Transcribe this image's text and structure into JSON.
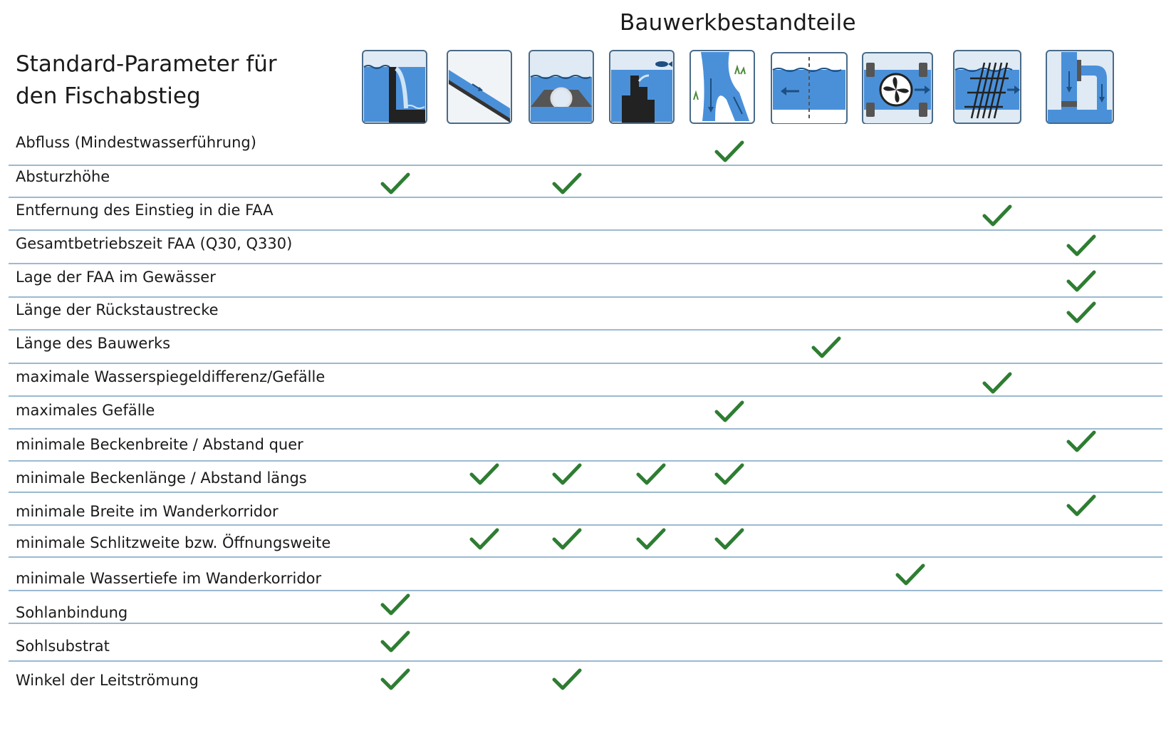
{
  "header": {
    "title": "Bauwerkbestandteile"
  },
  "table": {
    "title_lines": [
      "Standard-Parameter für",
      "den Fischabstieg"
    ],
    "columns": [
      {
        "icon": "waterfall-weir-icon"
      },
      {
        "icon": "ramp-slope-icon"
      },
      {
        "icon": "culvert-pipe-icon"
      },
      {
        "icon": "fish-pass-steps-icon"
      },
      {
        "icon": "river-bypass-icon"
      },
      {
        "icon": "channel-flow-icon"
      },
      {
        "icon": "turbine-icon"
      },
      {
        "icon": "screen-rake-icon"
      },
      {
        "icon": "bypass-pipe-icon"
      }
    ],
    "rows": [
      {
        "label": "Abfluss (Mindestwasserführung)",
        "checks": [
          5
        ]
      },
      {
        "label": "Absturzhöhe",
        "checks": [
          1,
          3
        ]
      },
      {
        "label": "Entfernung des Einstieg in die FAA",
        "checks": [
          8
        ]
      },
      {
        "label": "Gesamtbetriebszeit  FAA (Q30, Q330)",
        "checks": [
          9
        ]
      },
      {
        "label": "Lage der FAA im Gewässer",
        "checks": [
          9
        ]
      },
      {
        "label": "Länge der Rückstaustrecke",
        "checks": [
          9
        ]
      },
      {
        "label": "Länge des Bauwerks",
        "checks": [
          6
        ]
      },
      {
        "label": "maximale Wasserspiegeldifferenz/Gefälle",
        "checks": [
          8
        ]
      },
      {
        "label": "maximales Gefälle",
        "checks": [
          5
        ]
      },
      {
        "label": "minimale Beckenbreite / Abstand quer",
        "checks": [
          9
        ]
      },
      {
        "label": "minimale Beckenlänge / Abstand längs",
        "checks": [
          2,
          3,
          4,
          5
        ]
      },
      {
        "label": "minimale Breite im Wanderkorridor",
        "checks": [
          9
        ]
      },
      {
        "label": "minimale Schlitzweite bzw. Öffnungsweite",
        "checks": [
          2,
          3,
          4,
          5
        ]
      },
      {
        "label": "minimale Wassertiefe im Wanderkorridor",
        "checks": [
          7
        ]
      },
      {
        "label": "Sohlanbindung",
        "checks": [
          1
        ]
      },
      {
        "label": "Sohlsubstrat",
        "checks": [
          1
        ]
      },
      {
        "label": "Winkel der Leitströmung",
        "checks": [
          1,
          3
        ]
      }
    ]
  },
  "colors": {
    "check": "#2e7d32",
    "water": "#4a90d9",
    "divider": "#9bbad0"
  }
}
